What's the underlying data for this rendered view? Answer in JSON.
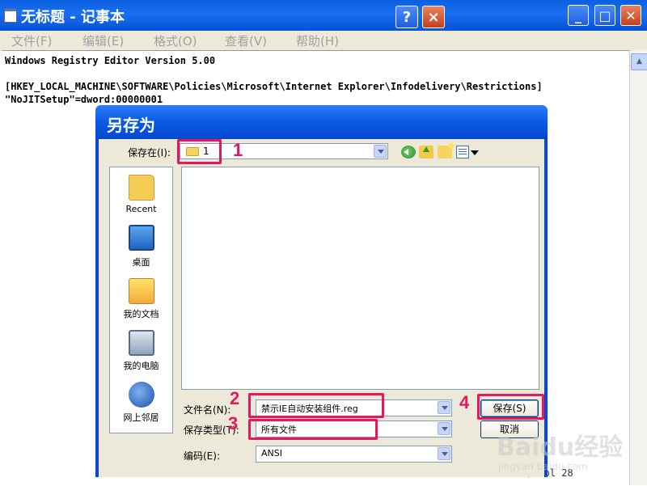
{
  "notepad": {
    "title": "无标题 - 记事本",
    "menu": [
      "文件(F)",
      "编辑(E)",
      "格式(O)",
      "查看(V)",
      "帮助(H)"
    ],
    "lines": [
      "Windows Registry Editor Version 5.00",
      "[HKEY_LOCAL_MACHINE\\SOFTWARE\\Policies\\Microsoft\\Internet Explorer\\Infodelivery\\Restrictions]",
      "\"NoJITSetup\"=dword:00000001"
    ],
    "status": "Ln 4, Col 28"
  },
  "dialog": {
    "title": "另存为",
    "help_label": "?",
    "close_label": "×",
    "save_in_label": "保存在(I):",
    "save_in_value": "1",
    "places": [
      {
        "label": "Recent",
        "icon": "recent-folder-icon"
      },
      {
        "label": "桌面",
        "icon": "desktop-icon"
      },
      {
        "label": "我的文档",
        "icon": "my-documents-icon"
      },
      {
        "label": "我的电脑",
        "icon": "my-computer-icon"
      },
      {
        "label": "网上邻居",
        "icon": "network-places-icon"
      }
    ],
    "filename_label": "文件名(N):",
    "filename_value": "禁示IE自动安装组件.reg",
    "filetype_label": "保存类型(T):",
    "filetype_value": "所有文件",
    "encoding_label": "编码(E):",
    "encoding_value": "ANSI",
    "save_button": "保存(S)",
    "cancel_button": "取消"
  },
  "annotations": {
    "labels": [
      "1",
      "2",
      "3",
      "4"
    ],
    "color": "#e6165f"
  },
  "watermark": {
    "brand": "Baidu经验",
    "url": "jingyan.baidu.com"
  },
  "colors": {
    "titlebar": "#0a5ae6",
    "dialog_face": "#ece9d8",
    "highlight": "#e6165f"
  }
}
